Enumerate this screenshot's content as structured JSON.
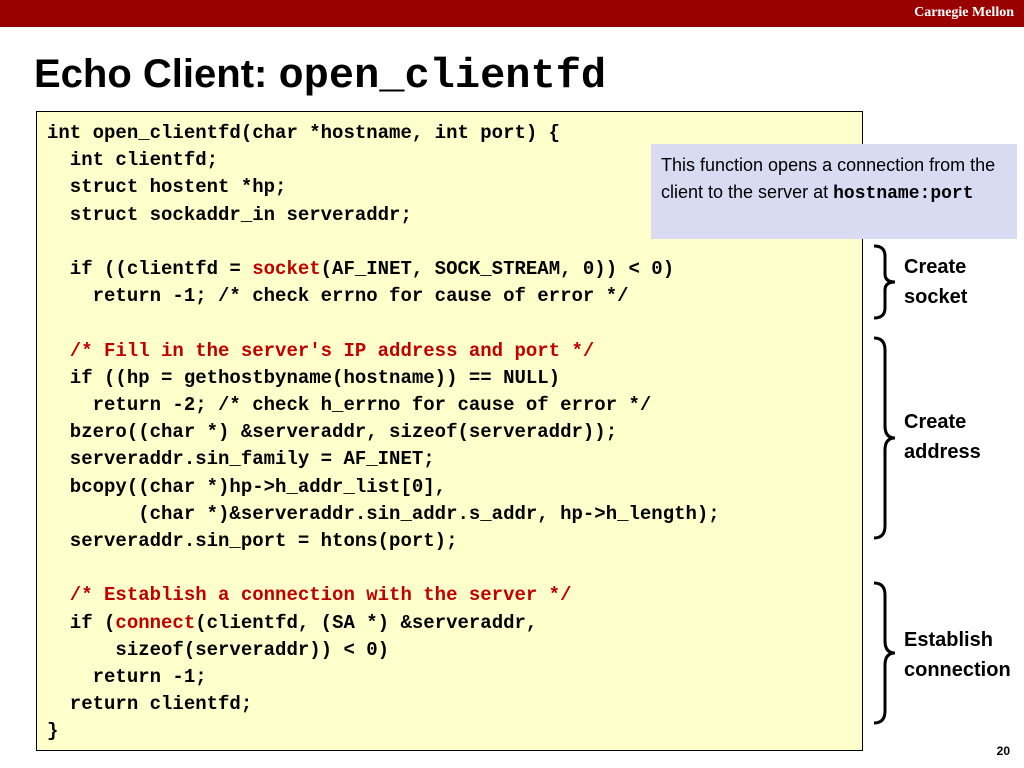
{
  "header": {
    "brand": "Carnegie Mellon"
  },
  "title": {
    "text": "Echo Client: ",
    "code": "open_clientfd"
  },
  "code_lines": [
    [
      {
        "t": "int open_clientfd(char *hostname, int port) {"
      }
    ],
    [
      {
        "t": "  int clientfd;"
      }
    ],
    [
      {
        "t": "  struct hostent *hp;"
      }
    ],
    [
      {
        "t": "  struct sockaddr_in serveraddr;"
      }
    ],
    [],
    [
      {
        "t": "  if ((clientfd = "
      },
      {
        "t": "socket",
        "hl": true
      },
      {
        "t": "(AF_INET, SOCK_STREAM, 0)) < 0)"
      }
    ],
    [
      {
        "t": "    return -1; /* check errno for cause of error */"
      }
    ],
    [],
    [
      {
        "t": "  /* Fill in the server's IP address and port */",
        "hl": true
      }
    ],
    [
      {
        "t": "  if ((hp = gethostbyname(hostname)) == NULL)"
      }
    ],
    [
      {
        "t": "    return -2; /* check h_errno for cause of error */"
      }
    ],
    [
      {
        "t": "  bzero((char *) &serveraddr, sizeof(serveraddr));"
      }
    ],
    [
      {
        "t": "  serveraddr.sin_family = AF_INET;"
      }
    ],
    [
      {
        "t": "  bcopy((char *)hp->h_addr_list[0],"
      }
    ],
    [
      {
        "t": "        (char *)&serveraddr.sin_addr.s_addr, hp->h_length);"
      }
    ],
    [
      {
        "t": "  serveraddr.sin_port = htons(port);"
      }
    ],
    [],
    [
      {
        "t": "  /* Establish a connection with the server */",
        "hl": true
      }
    ],
    [
      {
        "t": "  if ("
      },
      {
        "t": "connect",
        "hl": true
      },
      {
        "t": "(clientfd, (SA *) &serveraddr,"
      }
    ],
    [
      {
        "t": "      sizeof(serveraddr)) < 0)"
      }
    ],
    [
      {
        "t": "    return -1;"
      }
    ],
    [
      {
        "t": "  return clientfd;"
      }
    ],
    [
      {
        "t": "}"
      }
    ]
  ],
  "note": {
    "text": "This function opens a connection from the client to the server at",
    "code": "hostname:port"
  },
  "annotations": [
    {
      "label": "Create\nsocket"
    },
    {
      "label": "Create\naddress"
    },
    {
      "label": "Establish\nconnection"
    }
  ],
  "page_number": "20",
  "colors": {
    "header_bar": "#990000",
    "code_background": "#ffffcc",
    "highlight": "#c00000",
    "note_background": "#d9dbf3"
  }
}
